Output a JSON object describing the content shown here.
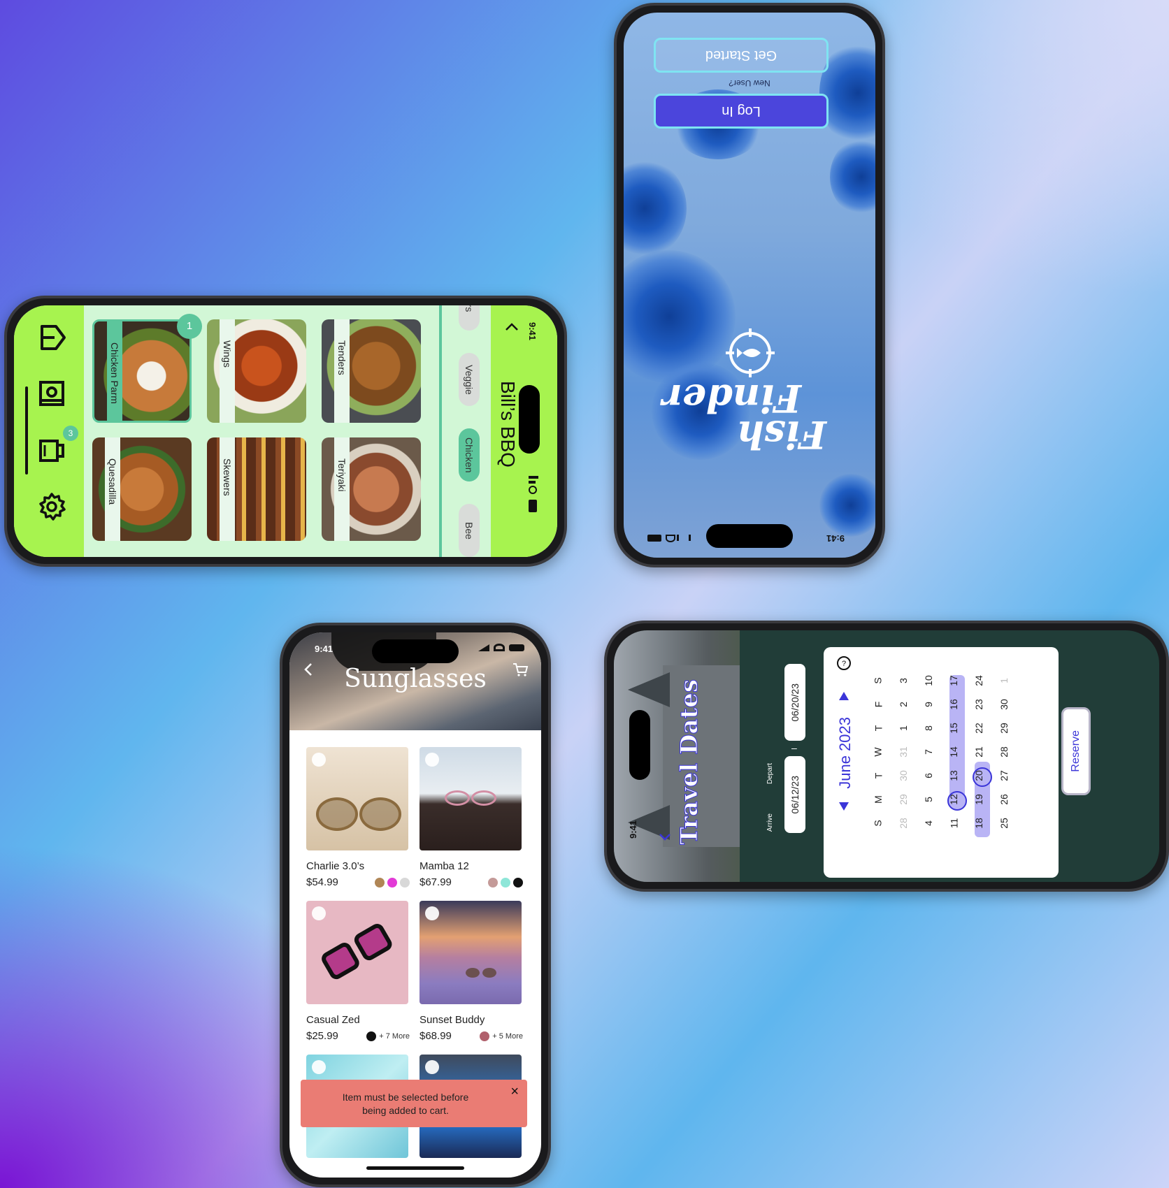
{
  "colors": {
    "bbq_green": "#a7f34f",
    "bbq_mint": "#5cc69c",
    "fish_button": "#4b45dc",
    "travel_bg": "#213d38",
    "calendar_range": "#b9b4f5",
    "toast_bg": "#ea7c74",
    "accent_blue": "#3b35d8"
  },
  "bbq": {
    "status_time": "9:41",
    "title": "Bill’s BBQ",
    "back_icon": "chevron-back-icon",
    "categories": [
      "ters",
      "Veggie",
      "Chicken",
      "Bee"
    ],
    "selected_category": "Chicken",
    "items": [
      {
        "label": "Chicken Parm",
        "badge": "1",
        "selected": true
      },
      {
        "label": "Wings"
      },
      {
        "label": "Tenders"
      },
      {
        "label": "Quesadilla"
      },
      {
        "label": "Skewers"
      },
      {
        "label": "Teriyaki"
      }
    ],
    "nav": [
      {
        "name": "exit-icon"
      },
      {
        "name": "menu-icon"
      },
      {
        "name": "cart-icon",
        "badge": "3"
      },
      {
        "name": "settings-icon"
      }
    ]
  },
  "fish": {
    "status_time": "9:41",
    "title_line1": "Fish",
    "title_line2": "Finder",
    "logo_icon": "fish-target-icon",
    "login_label": "Log In",
    "new_user_label": "New User?",
    "get_started_label": "Get Started"
  },
  "sunglasses": {
    "status_time": "9:41",
    "title": "Sunglasses",
    "back_icon": "chevron-back-icon",
    "cart_icon": "cart-icon",
    "products": [
      {
        "name": "Charlie 3.0’s",
        "price": "$54.99",
        "swatches": [
          "#b08656",
          "#e23ad6",
          "#d8d8d8"
        ]
      },
      {
        "name": "Mamba 12",
        "price": "$67.99",
        "swatches": [
          "#c49a98",
          "#8ee6d8",
          "#111111"
        ]
      },
      {
        "name": "Casual Zed",
        "price": "$25.99",
        "swatches": [
          "#111111"
        ],
        "more": "+ 7 More"
      },
      {
        "name": "Sunset Buddy",
        "price": "$68.99",
        "swatches": [
          "#b0606c"
        ],
        "more": "+ 5 More"
      },
      {
        "name": "",
        "price": ""
      },
      {
        "name": "",
        "price": ""
      }
    ],
    "toast": {
      "message_line1": "Item must be selected before",
      "message_line2": "being added to cart.",
      "close": "×"
    }
  },
  "travel": {
    "status_time": "9:41",
    "title": "Travel Dates",
    "down_icon": "chevron-down-icon",
    "arrive_label": "Arrive",
    "arrive_value": "06/12/23",
    "depart_label": "Depart",
    "depart_value": "06/20/23",
    "dash": "–",
    "month": "June 2023",
    "help_icon": "help-icon",
    "weekdays": [
      "S",
      "M",
      "T",
      "W",
      "T",
      "F",
      "S"
    ],
    "weeks": [
      [
        "28",
        "29",
        "30",
        "31",
        "1",
        "2",
        "3"
      ],
      [
        "4",
        "5",
        "6",
        "7",
        "8",
        "9",
        "10"
      ],
      [
        "11",
        "12",
        "13",
        "14",
        "15",
        "16",
        "17"
      ],
      [
        "18",
        "19",
        "20",
        "21",
        "22",
        "23",
        "24"
      ],
      [
        "25",
        "26",
        "27",
        "28",
        "29",
        "30",
        "1"
      ]
    ],
    "range_start": "12",
    "range_end": "20",
    "reserve_label": "Reserve"
  }
}
